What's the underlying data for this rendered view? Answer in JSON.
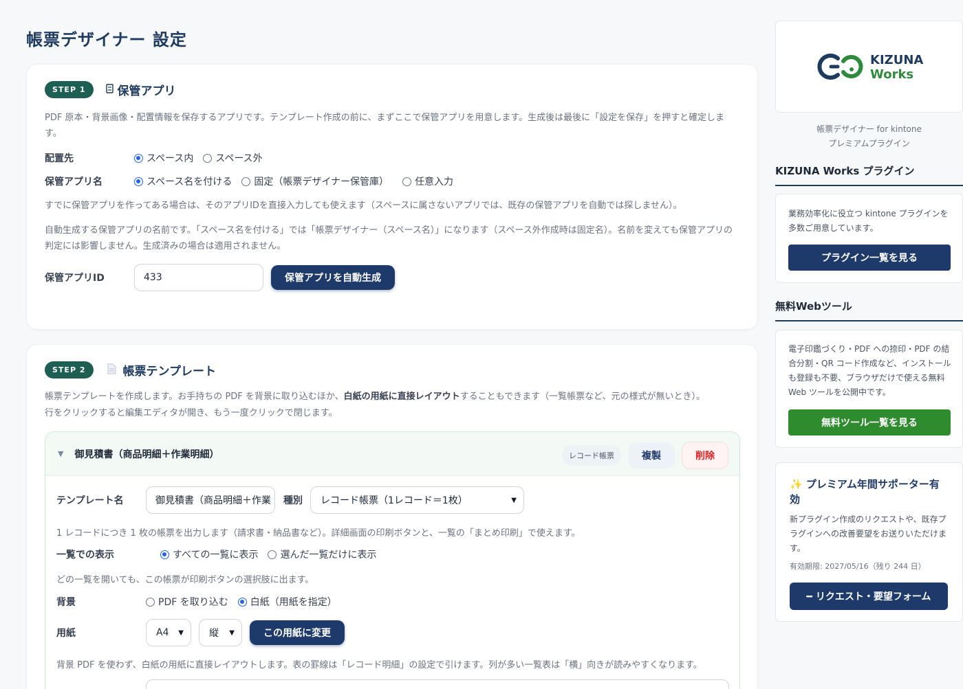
{
  "page": {
    "title": "帳票デザイナー 設定"
  },
  "step1": {
    "badge": "STEP 1",
    "icon": "storage-icon",
    "title": "保管アプリ",
    "desc": "PDF 原本・背景画像・配置情報を保存するアプリです。テンプレート作成の前に、まずここで保管アプリを用意します。生成後は最後に「設定を保存」を押すと確定します。",
    "placement_label": "配置先",
    "placement_options": [
      "スペース内",
      "スペース外"
    ],
    "placement_selected": 0,
    "appname_label": "保管アプリ名",
    "appname_options": [
      "スペース名を付ける",
      "固定（帳票デザイナー保管庫）",
      "任意入力"
    ],
    "appname_selected": 0,
    "note1": "すでに保管アプリを作ってある場合は、そのアプリIDを直接入力しても使えます（スペースに属さないアプリでは、既存の保管アプリを自動では探しません）。",
    "note2": "自動生成する保管アプリの名前です。「スペース名を付ける」では「帳票デザイナー（スペース名）」になります（スペース外作成時は固定名）。名前を変えても保管アプリの判定には影響しません。生成済みの場合は適用されません。",
    "appid_label": "保管アプリID",
    "appid_value": "433",
    "autogen_button": "保管アプリを自動生成"
  },
  "step2": {
    "badge": "STEP 2",
    "icon": "document-icon",
    "title": "帳票テンプレート",
    "desc_pre": "帳票テンプレートを作成します。お手持ちの PDF を背景に取り込むほか、",
    "desc_bold": "白紙の用紙に直接レイアウト",
    "desc_post": "することもできます（一覧帳票など、元の様式が無いとき）。",
    "desc2": "行をクリックすると編集エディタが開き、もう一度クリックで閉じます。",
    "template": {
      "arrow": "▼",
      "name": "御見積書（商品明細＋作業明細）",
      "chip": "レコード帳票",
      "duplicate_button": "複製",
      "delete_button": "削除",
      "name_label": "テンプレート名",
      "name_value": "御見積書（商品明細＋作業",
      "type_label": "種別",
      "type_value": "レコード帳票（1レコード＝1枚）",
      "type_desc": "1 レコードにつき 1 枚の帳票を出力します（請求書・納品書など）。詳細画面の印刷ボタンと、一覧の「まとめ印刷」で使えます。",
      "listview_label": "一覧での表示",
      "listview_options": [
        "すべての一覧に表示",
        "選んだ一覧だけに表示"
      ],
      "listview_selected": 0,
      "listview_desc": "どの一覧を開いても、この帳票が印刷ボタンの選択肢に出ます。",
      "bg_label": "背景",
      "bg_options": [
        "PDF を取り込む",
        "白紙（用紙を指定）"
      ],
      "bg_selected": 1,
      "paper_label": "用紙",
      "paper_size": "A4",
      "paper_orient": "縦",
      "paper_button": "この用紙に変更",
      "paper_desc": "背景 PDF を使わず、白紙の用紙に直接レイアウトします。表の罫線は「レコード明細」の設定で引けます。列が多い一覧表は「横」向きが読みやすくなります。"
    }
  },
  "sidebar": {
    "logo_line1": "KIZUNA",
    "logo_line2": "Works",
    "logo_colors": {
      "navy": "#1e3a5f",
      "green": "#2f8a3e"
    },
    "sub_line1": "帳票デザイナー for kintone",
    "sub_line2": "プレミアムプラグイン",
    "plugins_heading": "KIZUNA Works プラグイン",
    "plugins_text": "業務効率化に役立つ kintone プラグインを多数ご用意しています。",
    "plugins_button": "プラグイン一覧を見る",
    "tools_heading": "無料Webツール",
    "tools_text": "電子印鑑づくり・PDF への捺印・PDF の結合分割・QR コード作成など、インストールも登録も不要、ブラウザだけで使える無料 Web ツールを公開中です。",
    "tools_button": "無料ツール一覧を見る",
    "premium_icon": "sparkle-icon",
    "premium_title": "プレミアム年間サポーター有効",
    "premium_text": "新プラグイン作成のリクエストや、既存プラグインへの改善要望をお送りいただけます。",
    "premium_expiry": "有効期限: 2027/05/16（残り 244 日）",
    "request_button": "━ リクエスト・要望フォーム"
  }
}
